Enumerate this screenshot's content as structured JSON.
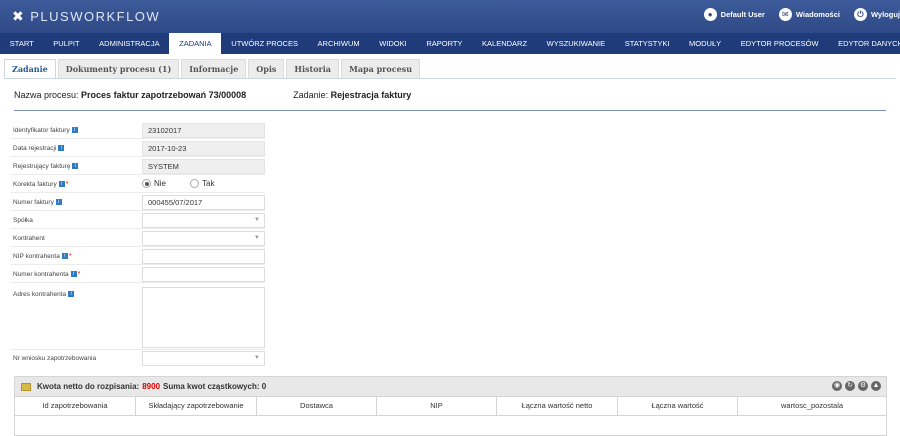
{
  "app": {
    "logo_text": "PLUSWORKFLOW"
  },
  "user_menu": [
    {
      "label": "Default User",
      "icon": "user-icon",
      "glyph": "●"
    },
    {
      "label": "Wiadomości",
      "icon": "mail-icon",
      "glyph": "✉"
    },
    {
      "label": "Wyloguj",
      "icon": "power-icon",
      "glyph": "⏻"
    }
  ],
  "main_nav": [
    "START",
    "PULPIT",
    "ADMINISTRACJA",
    "ZADANIA",
    "UTWÓRZ PROCES",
    "ARCHIWUM",
    "WIDOKI",
    "RAPORTY",
    "KALENDARZ",
    "WYSZUKIWANIE",
    "STATYSTYKI",
    "MODUŁY",
    "EDYTOR PROCESÓW",
    "EDYTOR DANYCH"
  ],
  "main_nav_active": "ZADANIA",
  "sub_tabs": [
    "Zadanie",
    "Dokumenty procesu (1)",
    "Informacje",
    "Opis",
    "Historia",
    "Mapa procesu"
  ],
  "sub_tab_active": "Zadanie",
  "header": {
    "process_label": "Nazwa procesu:",
    "process_name": "Proces faktur zapotrzebowań 73/00008",
    "task_label": "Zadanie:",
    "task_name": "Rejestracja faktury"
  },
  "form": {
    "id_label": "Identyfikator faktury",
    "id_value": "23102017",
    "date_label": "Data rejestracji",
    "date_value": "2017-10-23",
    "registrar_label": "Rejestrujący fakturę",
    "registrar_value": "SYSTEM",
    "correction_label": "Korekta faktury",
    "correction_no": "Nie",
    "correction_yes": "Tak",
    "number_label": "Numer faktury",
    "number_value": "000455/07/2017",
    "company_label": "Spółka",
    "company_value": "",
    "contractor_label": "Kontrahent",
    "contractor_value": "",
    "nip_label": "NIP kontrahenta",
    "nip_value": "",
    "contractor_number_label": "Numer kontrahenta",
    "contractor_number_value": "",
    "address_label": "Adres kontrahenta",
    "address_value": "",
    "request_label": "Nr wniosku zapotrzebowania",
    "request_value": ""
  },
  "grid": {
    "title_prefix": "Kwota netto do rozpisania:",
    "amount": "8900",
    "title_suffix": "Suma kwot cząstkowych: 0",
    "columns": [
      "Id zapotrzebowania",
      "Składający zapotrzebowanie",
      "Dostawca",
      "NIP",
      "Łączna wartość netto",
      "Łączna wartość",
      "wartosc_pozostala"
    ],
    "icons": [
      "collapse-icon",
      "refresh-icon",
      "settings-icon",
      "toggle-icon"
    ]
  },
  "colors": {
    "nav": "#1f3b7a",
    "topbar": "#2f4a86",
    "accent": "#1f5b99",
    "amount": "#e00000"
  }
}
